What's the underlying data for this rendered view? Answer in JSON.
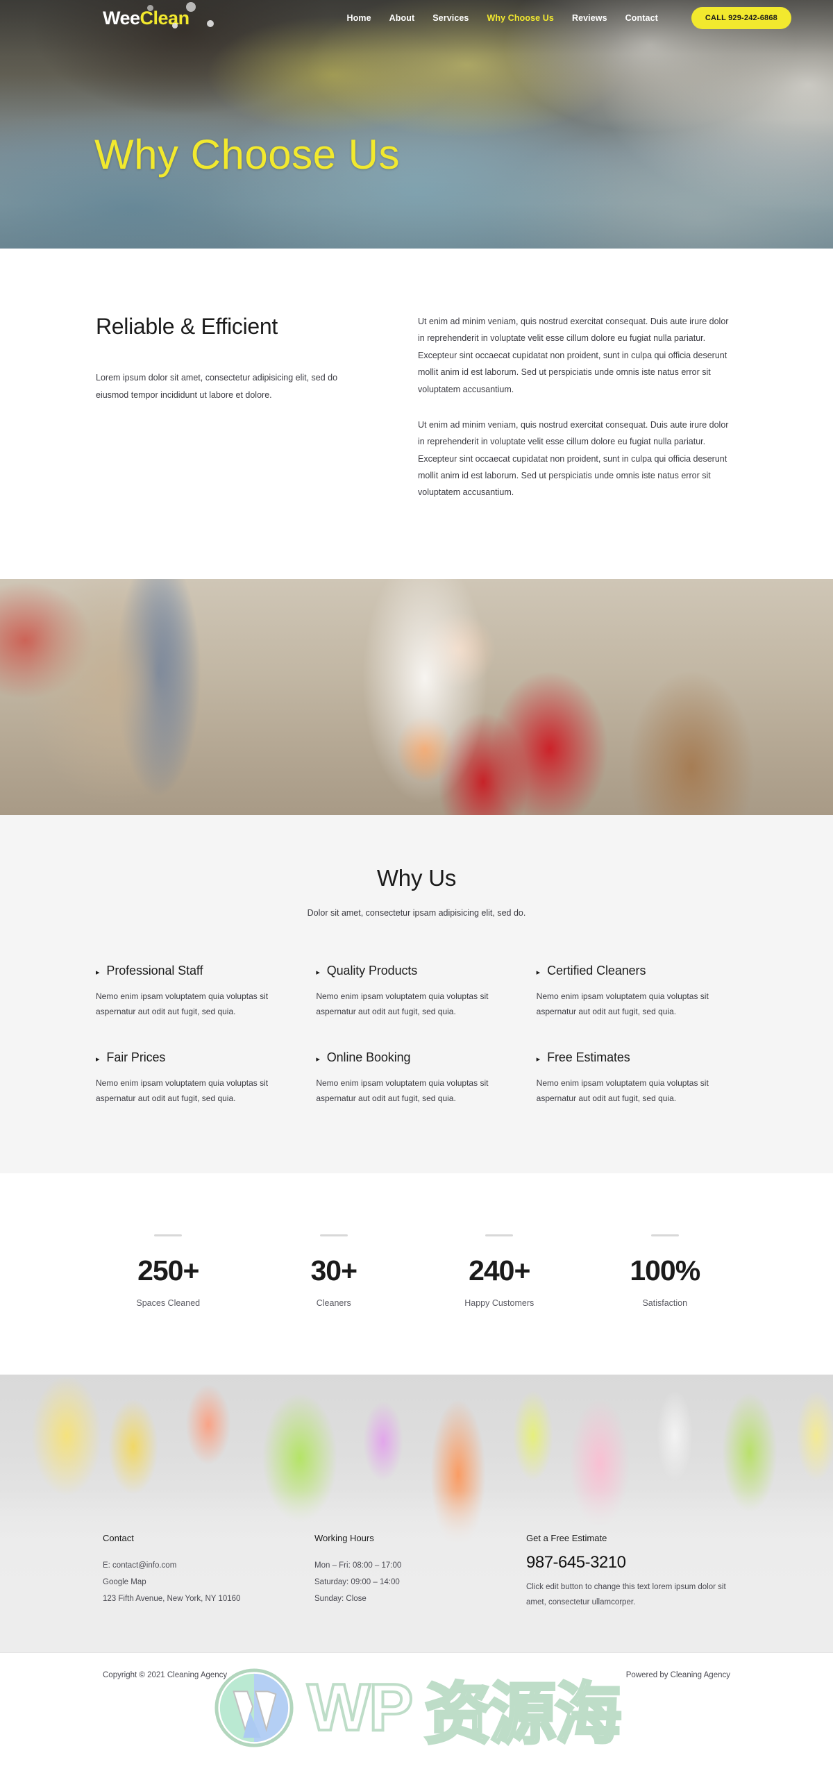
{
  "nav": {
    "brand_part1": "Wee",
    "brand_part2": "Clean",
    "links": [
      {
        "label": "Home",
        "active": false
      },
      {
        "label": "About",
        "active": false
      },
      {
        "label": "Services",
        "active": false
      },
      {
        "label": "Why Choose Us",
        "active": true
      },
      {
        "label": "Reviews",
        "active": false
      },
      {
        "label": "Contact",
        "active": false
      }
    ],
    "call_button": "CALL 929-242-6868",
    "accent_color": "#f2e92e"
  },
  "hero": {
    "title": "Why Choose Us"
  },
  "intro": {
    "heading": "Reliable & Efficient",
    "subtext": "Lorem ipsum dolor sit amet, consectetur adipisicing elit, sed do eiusmod tempor incididunt ut labore et dolore.",
    "paragraph1": "Ut enim ad minim veniam, quis nostrud exercitat consequat. Duis aute irure dolor in reprehenderit in voluptate velit esse cillum dolore eu fugiat nulla pariatur. Excepteur sint occaecat cupidatat non proident, sunt in culpa qui officia deserunt mollit anim id est laborum. Sed ut perspiciatis unde omnis iste natus error sit voluptatem accusantium.",
    "paragraph2": "Ut enim ad minim veniam, quis nostrud exercitat consequat. Duis aute irure dolor in reprehenderit in voluptate velit esse cillum dolore eu fugiat nulla pariatur. Excepteur sint occaecat cupidatat non proident, sunt in culpa qui officia deserunt mollit anim id est laborum. Sed ut perspiciatis unde omnis iste natus error sit voluptatem accusantium."
  },
  "why_us": {
    "heading": "Why Us",
    "subheading": "Dolor sit amet, consectetur ipsam adipisicing elit, sed do.",
    "bullet_glyph": "▸",
    "features": [
      {
        "title": "Professional Staff",
        "text": "Nemo enim ipsam voluptatem quia voluptas sit aspernatur aut odit aut fugit, sed quia."
      },
      {
        "title": "Quality Products",
        "text": "Nemo enim ipsam voluptatem quia voluptas sit aspernatur aut odit aut fugit, sed quia."
      },
      {
        "title": "Certified Cleaners",
        "text": "Nemo enim ipsam voluptatem quia voluptas sit aspernatur aut odit aut fugit, sed quia."
      },
      {
        "title": "Fair Prices",
        "text": "Nemo enim ipsam voluptatem quia voluptas sit aspernatur aut odit aut fugit, sed quia."
      },
      {
        "title": "Online Booking",
        "text": "Nemo enim ipsam voluptatem quia voluptas sit aspernatur aut odit aut fugit, sed quia."
      },
      {
        "title": "Free Estimates",
        "text": "Nemo enim ipsam voluptatem quia voluptas sit aspernatur aut odit aut fugit, sed quia."
      }
    ]
  },
  "stats": [
    {
      "value": "250+",
      "label": "Spaces Cleaned"
    },
    {
      "value": "30+",
      "label": "Cleaners"
    },
    {
      "value": "240+",
      "label": "Happy Customers"
    },
    {
      "value": "100%",
      "label": "Satisfaction"
    }
  ],
  "footer": {
    "contact": {
      "heading": "Contact",
      "email": "E: contact@info.com",
      "map_link": "Google Map",
      "address": "123 Fifth Avenue, New York, NY 10160"
    },
    "hours": {
      "heading": "Working Hours",
      "line1": "Mon – Fri: 08:00 – 17:00",
      "line2": "Saturday: 09:00 – 14:00",
      "line3": "Sunday: Close"
    },
    "estimate": {
      "heading": "Get a Free Estimate",
      "phone": "987-645-3210",
      "note": "Click edit button to change this text lorem ipsum dolor sit amet, consectetur ullamcorper."
    }
  },
  "watermark": {
    "text_latin": "WP",
    "text_cn": "资源海"
  },
  "copyright": {
    "left": "Copyright © 2021 Cleaning Agency",
    "right": "Powered by Cleaning Agency"
  }
}
